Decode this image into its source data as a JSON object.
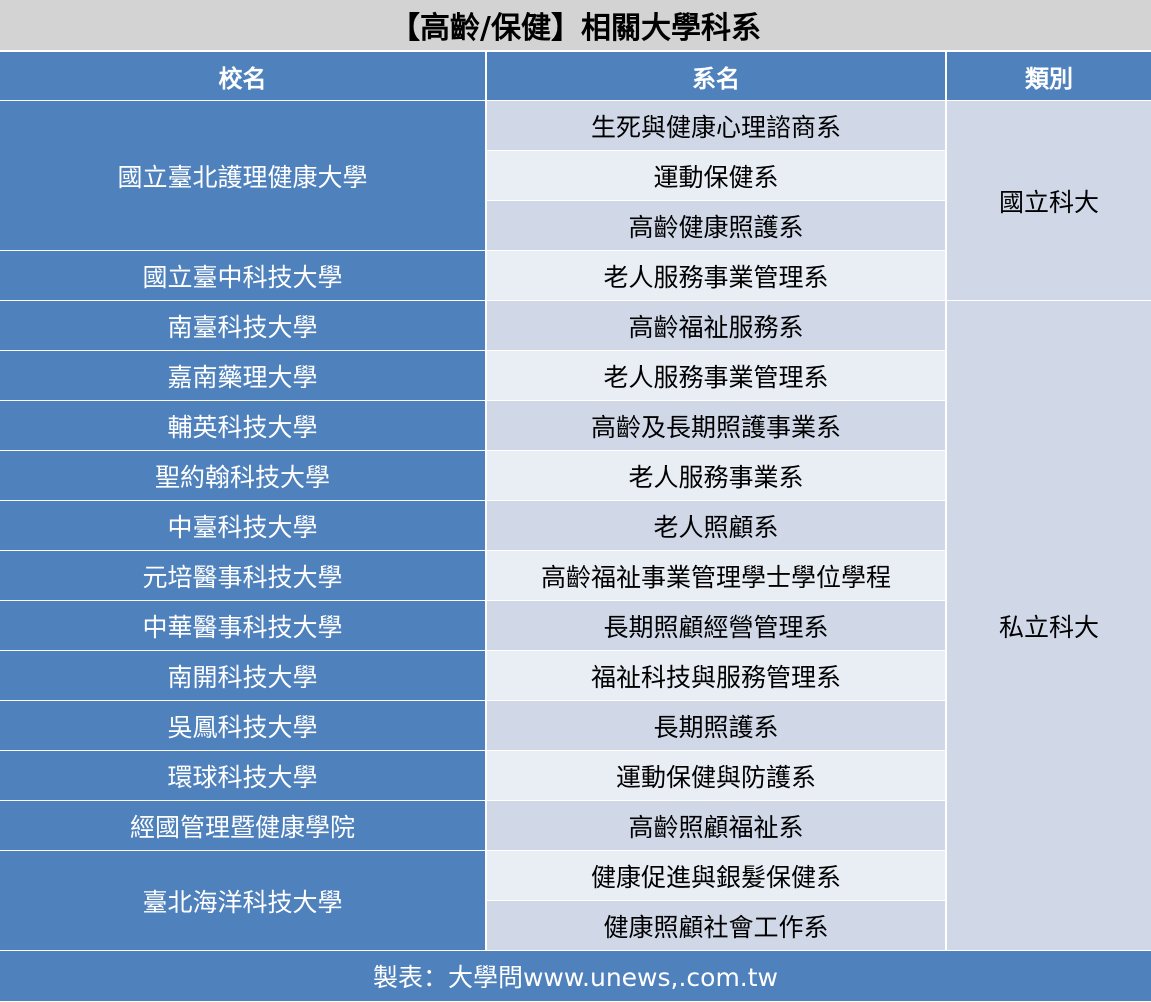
{
  "title": "【高齡/保健】相關大學科系",
  "headers": {
    "school": "校名",
    "dept": "系名",
    "type": "類別"
  },
  "schools": [
    "國立臺北護理健康大學",
    "國立臺中科技大學",
    "南臺科技大學",
    "嘉南藥理大學",
    "輔英科技大學",
    "聖約翰科技大學",
    "中臺科技大學",
    "元培醫事科技大學",
    "中華醫事科技大學",
    "南開科技大學",
    "吳鳳科技大學",
    "環球科技大學",
    "經國管理暨健康學院",
    "臺北海洋科技大學"
  ],
  "departments": [
    "生死與健康心理諮商系",
    "運動保健系",
    "高齡健康照護系",
    "老人服務事業管理系",
    "高齡福祉服務系",
    "老人服務事業管理系",
    "高齡及長期照護事業系",
    "老人服務事業系",
    "老人照顧系",
    "高齡福祉事業管理學士學位學程",
    "長期照顧經營管理系",
    "福祉科技與服務管理系",
    "長期照護系",
    "運動保健與防護系",
    "高齡照顧福祉系",
    "健康促進與銀髮保健系",
    "健康照顧社會工作系"
  ],
  "types": {
    "national": "國立科大",
    "private": "私立科大"
  },
  "footer": "製表：大學問www.unews,.com.tw"
}
